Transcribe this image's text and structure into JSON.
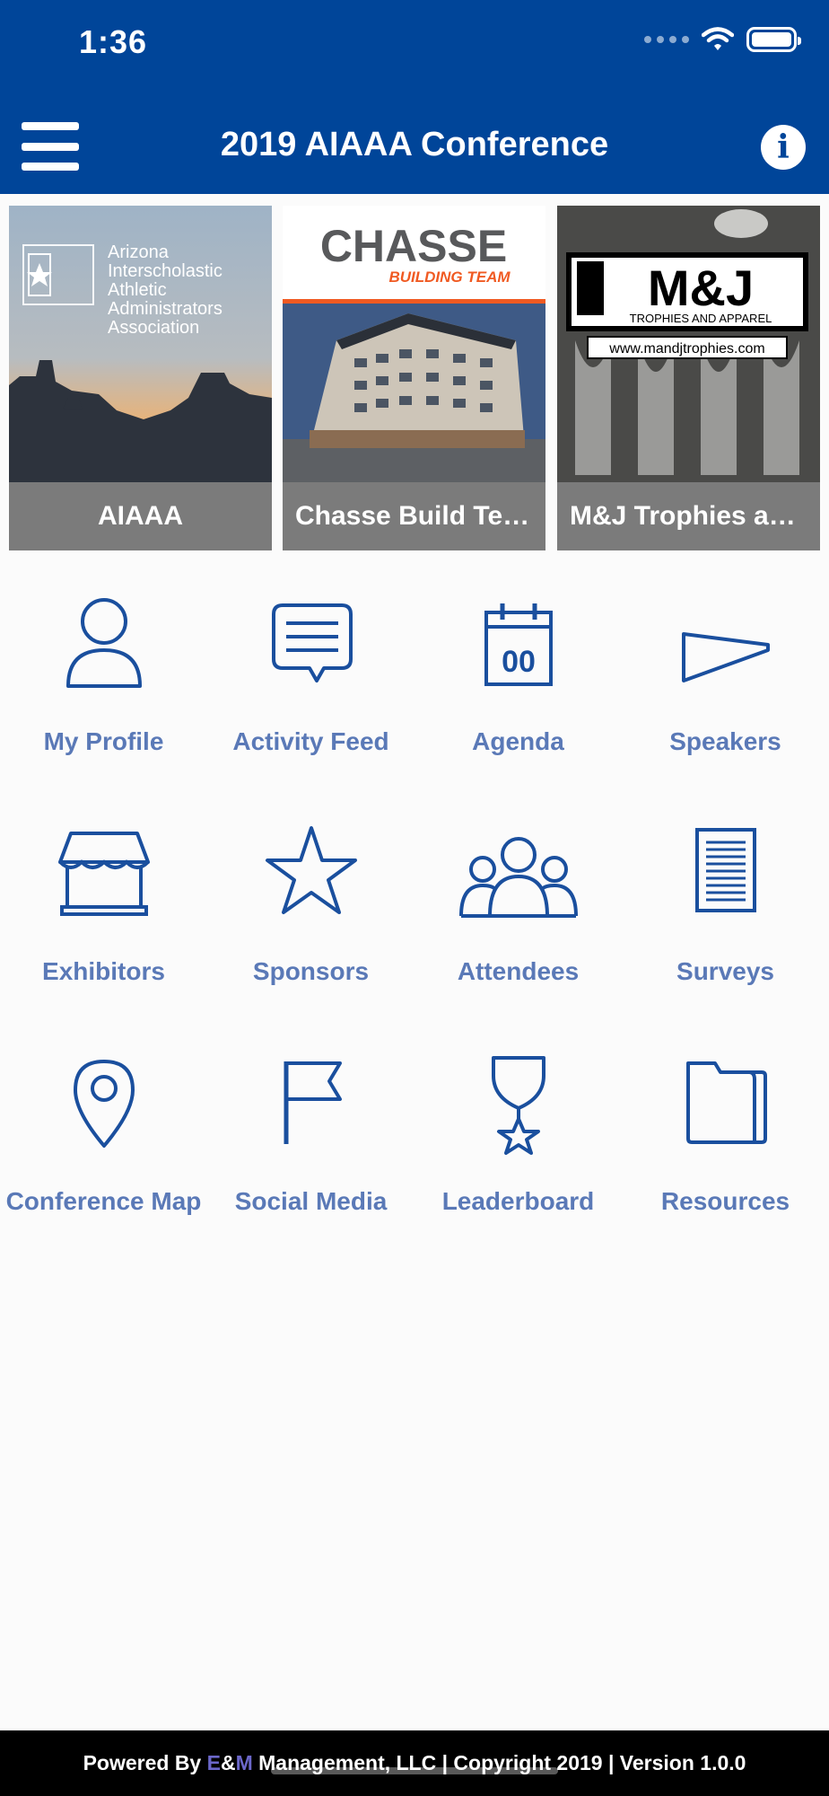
{
  "status_bar": {
    "time": "1:36"
  },
  "header": {
    "title": "2019 AIAAA Conference"
  },
  "sponsors": [
    {
      "label": "AIAAA",
      "logo_lines": [
        "Arizona",
        "Interscholastic",
        "Athletic",
        "Administrators",
        "Association"
      ]
    },
    {
      "label": "Chasse Build Team",
      "logo_main": "CHASSE",
      "logo_sub": "BUILDING TEAM"
    },
    {
      "label": "M&J Trophies an...",
      "logo_main": "M&J",
      "logo_sub": "TROPHIES AND APPAREL",
      "logo_url": "www.mandjtrophies.com"
    }
  ],
  "menu": [
    {
      "label": "My Profile",
      "icon": "person-icon"
    },
    {
      "label": "Activity Feed",
      "icon": "chat-bubble-icon"
    },
    {
      "label": "Agenda",
      "icon": "calendar-icon",
      "icon_text": "00"
    },
    {
      "label": "Speakers",
      "icon": "megaphone-icon"
    },
    {
      "label": "Exhibitors",
      "icon": "booth-icon"
    },
    {
      "label": "Sponsors",
      "icon": "star-icon"
    },
    {
      "label": "Attendees",
      "icon": "people-group-icon"
    },
    {
      "label": "Surveys",
      "icon": "document-lines-icon"
    },
    {
      "label": "Conference Map",
      "icon": "map-pin-icon"
    },
    {
      "label": "Social Media",
      "icon": "flag-icon"
    },
    {
      "label": "Leaderboard",
      "icon": "medal-icon"
    },
    {
      "label": "Resources",
      "icon": "folder-icon"
    }
  ],
  "footer": {
    "prefix": "Powered By ",
    "brand_e": "E",
    "brand_amp": "&",
    "brand_m": "M",
    "suffix": " Management, LLC | Copyright 2019 | Version 1.0.0"
  },
  "colors": {
    "header_bg": "#004599",
    "icon_blue": "#1a4f9e",
    "label_blue": "#5a79b7",
    "footer_bg": "#000000"
  }
}
